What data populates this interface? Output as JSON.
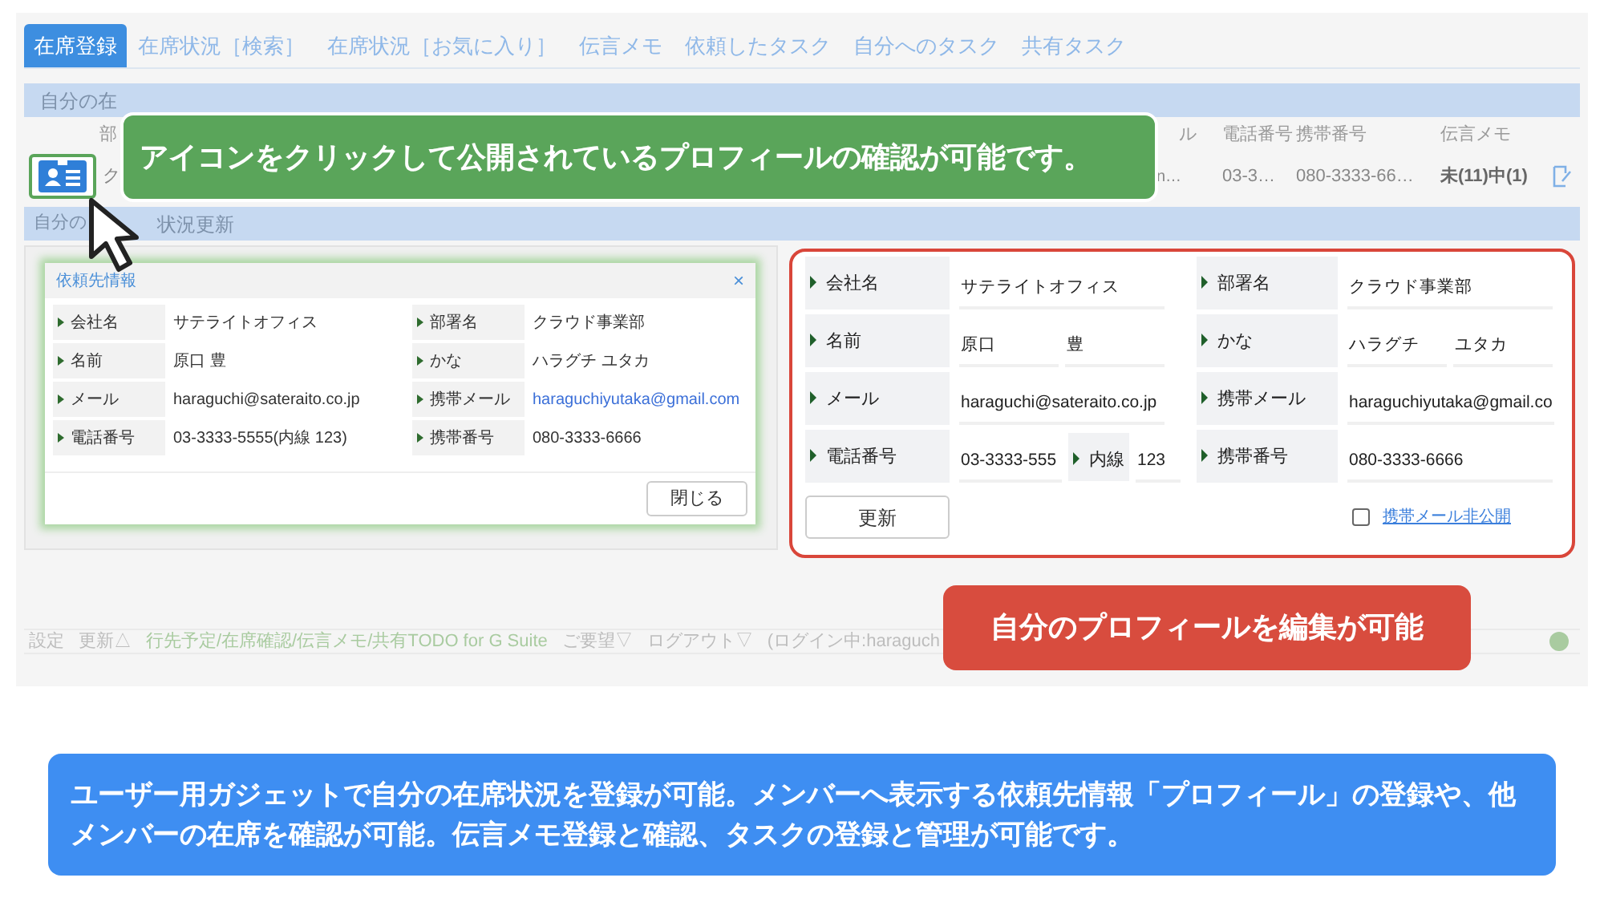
{
  "tabs": [
    {
      "label": "在席登録",
      "selected": true
    },
    {
      "label": "在席状況［検索］",
      "selected": false
    },
    {
      "label": "在席状況［お気に入り］",
      "selected": false
    },
    {
      "label": "伝言メモ",
      "selected": false
    },
    {
      "label": "依頼したタスク",
      "selected": false
    },
    {
      "label": "自分へのタスク",
      "selected": false
    },
    {
      "label": "共有タスク",
      "selected": false
    }
  ],
  "status_section": {
    "title": "自分の在",
    "columns": [
      "部",
      "ル",
      "電話番号",
      "携帯番号",
      "伝言メモ"
    ],
    "row": [
      "ク",
      "n…",
      "03-3…",
      "080-3333-66…",
      "未(11)中(1)"
    ]
  },
  "update_section": {
    "title_parts": [
      "自分の",
      "状況更新"
    ]
  },
  "dialog": {
    "title": "依頼先情報",
    "close": "×",
    "rows": [
      {
        "label": "会社名",
        "value": "サテライトオフィス",
        "kind": "text"
      },
      {
        "label": "部署名",
        "value": "クラウド事業部",
        "kind": "text"
      },
      {
        "label": "名前",
        "value": "原口 豊",
        "kind": "text"
      },
      {
        "label": "かな",
        "value": "ハラグチ ユタカ",
        "kind": "text"
      },
      {
        "label": "メール",
        "value": "haraguchi@sateraito.co.jp",
        "kind": "text"
      },
      {
        "label": "携帯メール",
        "value": "haraguchiyutaka@gmail.com",
        "kind": "link"
      },
      {
        "label": "電話番号",
        "value": "03-3333-5555(内線 123)",
        "kind": "text"
      },
      {
        "label": "携帯番号",
        "value": "080-3333-6666",
        "kind": "text"
      }
    ],
    "close_button": "閉じる"
  },
  "form": {
    "rows": [
      {
        "label": "会社名",
        "values": [
          "サテライトオフィス"
        ]
      },
      {
        "label": "部署名",
        "values": [
          "クラウド事業部"
        ]
      },
      {
        "label": "名前",
        "values": [
          "原口",
          "豊"
        ]
      },
      {
        "label": "かな",
        "values": [
          "ハラグチ",
          "ユタカ"
        ]
      },
      {
        "label": "メール",
        "values": [
          "haraguchi@sateraito.co.jp"
        ]
      },
      {
        "label": "携帯メール",
        "values": [
          "haraguchiyutaka@gmail.co"
        ]
      },
      {
        "label": "電話番号",
        "values": [
          "03-3333-555"
        ],
        "extension": {
          "label": "内線",
          "value": "123"
        }
      },
      {
        "label": "携帯番号",
        "values": [
          "080-3333-6666"
        ]
      }
    ],
    "update_button": "更新",
    "hide_mobile_mail": {
      "label": "携帯メール非公開",
      "checked": false
    }
  },
  "footer": [
    {
      "text": "設定",
      "kind": "plain"
    },
    {
      "text": "更新△",
      "kind": "plain"
    },
    {
      "text": "行先予定/在席確認/伝言メモ/共有TODO for G Suite",
      "kind": "link"
    },
    {
      "text": "ご要望▽",
      "kind": "plain"
    },
    {
      "text": "ログアウト▽",
      "kind": "plain"
    },
    {
      "text": "(ログイン中:haraguch",
      "kind": "plain"
    }
  ],
  "icon_callout": "アイコンをクリックして公開されているプロフィールの確認が可能です。",
  "edit_callout": "自分のプロフィールを編集が可能",
  "caption": "ユーザー用ガジェットで自分の在席状況を登録が可能。メンバーへ表示する依頼先情報「プロフィール」の登録や、他メンバーの在席を確認が可能。伝言メモ登録と確認、タスクの登録と管理が可能です。"
}
